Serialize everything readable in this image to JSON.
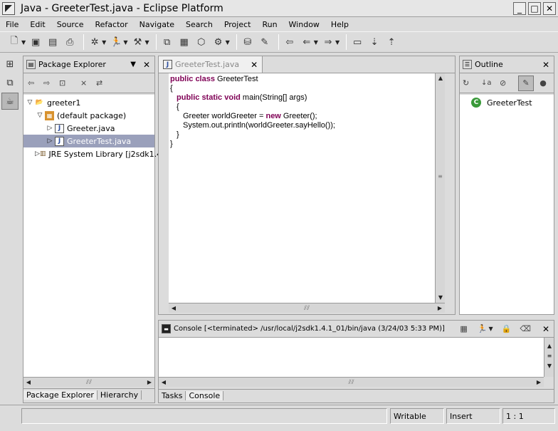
{
  "window": {
    "title": "Java - GreeterTest.java - Eclipse Platform",
    "min": "_",
    "max": "□",
    "close": "✕"
  },
  "menu": [
    "File",
    "Edit",
    "Source",
    "Refactor",
    "Navigate",
    "Search",
    "Project",
    "Run",
    "Window",
    "Help"
  ],
  "package_explorer": {
    "title": "Package Explorer",
    "tree": [
      {
        "label": "greeter1",
        "level": 0,
        "twisty": "▽",
        "icon": "project-icon"
      },
      {
        "label": "(default package)",
        "level": 1,
        "twisty": "▽",
        "icon": "package-icon"
      },
      {
        "label": "Greeter.java",
        "level": 2,
        "twisty": "▷",
        "icon": "java-file-icon"
      },
      {
        "label": "GreeterTest.java",
        "level": 2,
        "twisty": "▷",
        "icon": "java-file-icon",
        "selected": true
      },
      {
        "label": "JRE System Library [j2sdk1.4",
        "level": 1,
        "twisty": "▷",
        "icon": "library-icon"
      }
    ],
    "tabs": [
      "Package Explorer",
      "Hierarchy"
    ]
  },
  "editor": {
    "tab": "GreeterTest.java",
    "lines": [
      {
        "indent": 0,
        "parts": [
          {
            "kw": true,
            "t": "public class"
          },
          {
            "t": " GreeterTest"
          }
        ]
      },
      {
        "indent": 0,
        "parts": [
          {
            "t": "{"
          }
        ]
      },
      {
        "indent": 1,
        "parts": [
          {
            "kw": true,
            "t": "public static void"
          },
          {
            "t": " main(String[] args)"
          }
        ]
      },
      {
        "indent": 1,
        "parts": [
          {
            "t": "{"
          }
        ]
      },
      {
        "indent": 2,
        "parts": [
          {
            "t": "Greeter worldGreeter = "
          },
          {
            "kw": true,
            "t": "new"
          },
          {
            "t": " Greeter();"
          }
        ]
      },
      {
        "indent": 2,
        "parts": [
          {
            "t": "System.out.println(worldGreeter.sayHello());"
          }
        ]
      },
      {
        "indent": 1,
        "parts": [
          {
            "t": "}"
          }
        ]
      },
      {
        "indent": 0,
        "parts": [
          {
            "t": "}"
          }
        ]
      }
    ]
  },
  "outline": {
    "title": "Outline",
    "items": [
      {
        "label": "GreeterTest",
        "badge": "C"
      }
    ]
  },
  "console": {
    "title": "Console [<terminated> /usr/local/j2sdk1.4.1_01/bin/java (3/24/03 5:33 PM)]",
    "tabs": [
      "Tasks",
      "Console"
    ]
  },
  "status": {
    "writable": "Writable",
    "insert": "Insert",
    "position": "1 : 1"
  }
}
